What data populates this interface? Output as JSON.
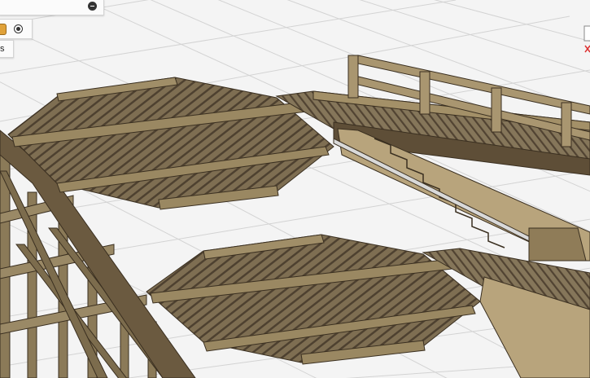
{
  "browser": {
    "label_fragment": "s",
    "icons": [
      "collapse-icon",
      "partial-visibility-icon",
      "radio-visibility-icon"
    ]
  },
  "viewport": {
    "background_color": "#f4f4f4",
    "grid_color": "#d3d3d3",
    "wood_light": "#8a7a5e",
    "wood_dark": "#5a4b36"
  }
}
